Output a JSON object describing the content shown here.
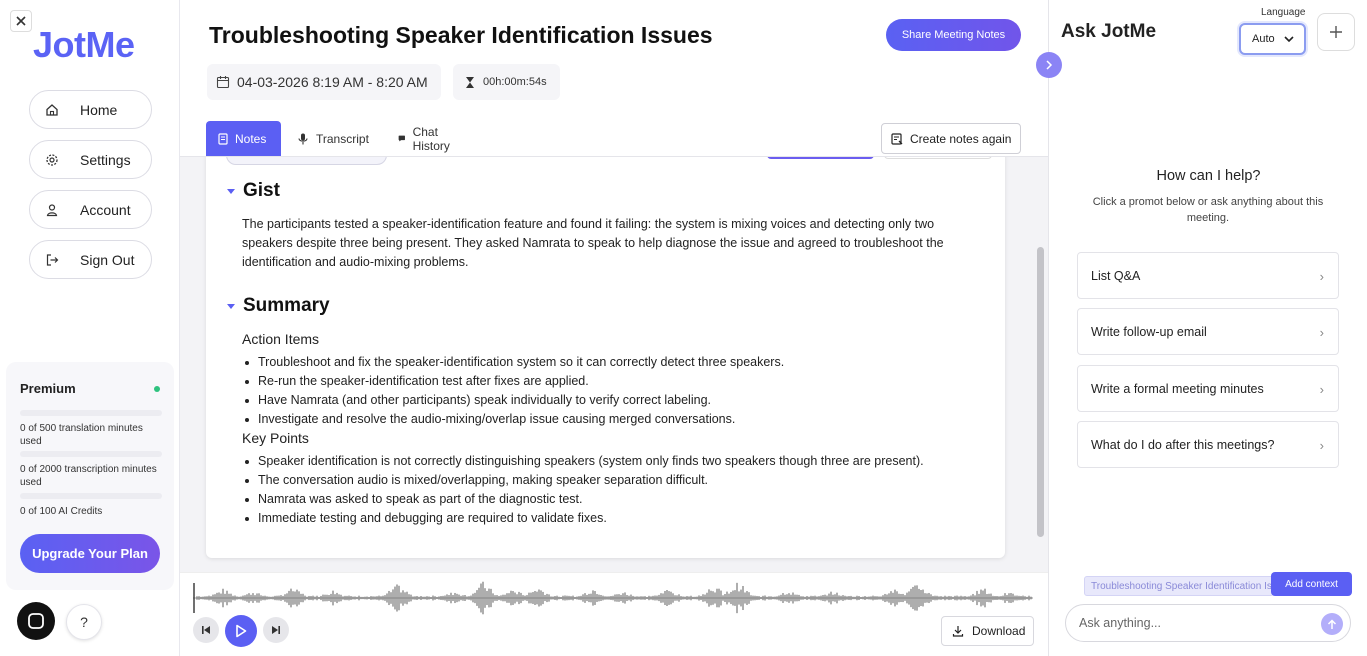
{
  "sidebar": {
    "logo": "JotMe",
    "nav": [
      {
        "label": "Home",
        "icon": "home-icon"
      },
      {
        "label": "Settings",
        "icon": "gear-icon"
      },
      {
        "label": "Account",
        "icon": "user-icon"
      },
      {
        "label": "Sign Out",
        "icon": "sign-out-icon"
      }
    ],
    "plan": {
      "title": "Premium",
      "status_color": "#2ec27e",
      "usage": [
        {
          "text": "0 of 500 translation minutes used",
          "fraction": 0
        },
        {
          "text": "0 of 2000 transcription minutes used",
          "fraction": 0
        },
        {
          "text": "0 of 100 AI Credits",
          "fraction": 0
        }
      ]
    },
    "upgrade_label": "Upgrade Your Plan",
    "help_label": "?"
  },
  "meeting": {
    "title": "Troubleshooting Speaker Identification Issues",
    "share_label": "Share Meeting Notes",
    "datetime": "04-03-2026 8:19 AM - 8:20 AM",
    "duration": "00h:00m:54s",
    "tabs": [
      {
        "label": "Notes",
        "icon": "document-icon",
        "active": true
      },
      {
        "label": "Transcript",
        "icon": "microphone-icon",
        "active": false
      },
      {
        "label": "Chat History",
        "icon": "chat-icon",
        "active": false
      }
    ],
    "create_notes_label": "Create notes again"
  },
  "notes": {
    "gist_heading": "Gist",
    "gist_text": "The participants tested a speaker-identification feature and found it failing: the system is mixing voices and detecting only two speakers despite three being present. They asked Namrata to speak to help diagnose the issue and agreed to troubleshoot the identification and audio-mixing problems.",
    "summary_heading": "Summary",
    "action_items_heading": "Action Items",
    "action_items": [
      "Troubleshoot and fix the speaker-identification system so it can correctly detect three speakers.",
      "Re-run the speaker-identification test after fixes are applied.",
      "Have Namrata (and other participants) speak individually to verify correct labeling.",
      "Investigate and resolve the audio-mixing/overlap issue causing merged conversations."
    ],
    "key_points_heading": "Key Points",
    "key_points": [
      "Speaker identification is not correctly distinguishing speakers (system only finds two speakers though three are present).",
      "The conversation audio is mixed/overlapping, making speaker separation difficult.",
      "Namrata was asked to speak as part of the diagnostic test.",
      "Immediate testing and debugging are required to validate fixes."
    ]
  },
  "player": {
    "download_label": "Download",
    "progress": 0
  },
  "assistant": {
    "title": "Ask JotMe",
    "language_label": "Language",
    "language_value": "Auto",
    "help_title": "How can I help?",
    "help_subtitle": "Click a promot below or ask anything about this meeting.",
    "prompts": [
      "List Q&A",
      "Write follow-up email",
      "Write a formal meeting minutes",
      "What do I do after this meetings?"
    ],
    "context_chip": "Troubleshooting Speaker Identification Issues",
    "add_context_label": "Add context",
    "input_placeholder": "Ask anything..."
  },
  "colors": {
    "accent": "#5b5ff3",
    "brand": "#5b63f5"
  }
}
